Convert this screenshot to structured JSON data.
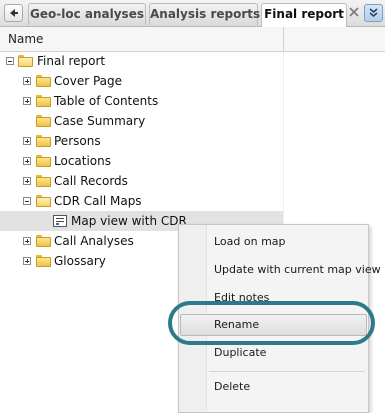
{
  "tabs": [
    {
      "label": "Geo-loc analyses"
    },
    {
      "label": "Analysis reports"
    },
    {
      "label": "Final report",
      "active": true
    }
  ],
  "column_header": {
    "name": "Name"
  },
  "tree": {
    "root": {
      "label": "Final report"
    },
    "items": [
      {
        "label": "Cover Page",
        "expander": "+"
      },
      {
        "label": "Table of Contents",
        "expander": "+"
      },
      {
        "label": "Case Summary",
        "expander": ""
      },
      {
        "label": "Persons",
        "expander": "+"
      },
      {
        "label": "Locations",
        "expander": "+"
      },
      {
        "label": "Call Records",
        "expander": "+"
      },
      {
        "label": "CDR Call Maps",
        "expander": "-"
      },
      {
        "label": "Map view with CDR",
        "type": "map-view",
        "selected": true
      },
      {
        "label": "Call Analyses",
        "expander": "+"
      },
      {
        "label": "Glossary",
        "expander": "+"
      }
    ]
  },
  "context_menu": {
    "items": [
      {
        "label": "Load on map"
      },
      {
        "label": "Update with current map view"
      },
      {
        "label": "Edit notes"
      },
      {
        "label": "Rename",
        "highlighted": true
      },
      {
        "label": "Duplicate"
      },
      {
        "label": "Delete"
      }
    ]
  },
  "colors": {
    "highlight_oval": "#2c7a8a",
    "selected_row": "#e2e2e2",
    "folder": "#f0c24a"
  }
}
